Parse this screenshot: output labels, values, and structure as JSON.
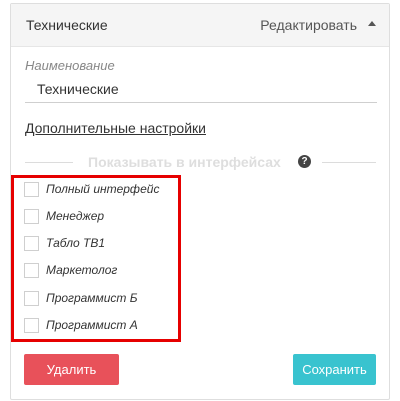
{
  "header": {
    "title": "Технические",
    "edit_label": "Редактировать"
  },
  "form": {
    "name_label": "Наименование",
    "name_value": "Технические",
    "extra_settings_link": "Дополнительные настройки"
  },
  "interfaces": {
    "section_title": "Показывать в интерфейсах",
    "help_icon": "?",
    "items": [
      {
        "label": "Полный интерфейс",
        "checked": false
      },
      {
        "label": "Менеджер",
        "checked": false
      },
      {
        "label": "Табло ТВ1",
        "checked": false
      },
      {
        "label": "Маркетолог",
        "checked": false
      },
      {
        "label": "Программист Б",
        "checked": false
      },
      {
        "label": "Программист А",
        "checked": false
      }
    ]
  },
  "actions": {
    "delete_label": "Удалить",
    "save_label": "Сохранить"
  },
  "colors": {
    "delete": "#e8515a",
    "save": "#39c3cf",
    "highlight": "#e60000"
  }
}
